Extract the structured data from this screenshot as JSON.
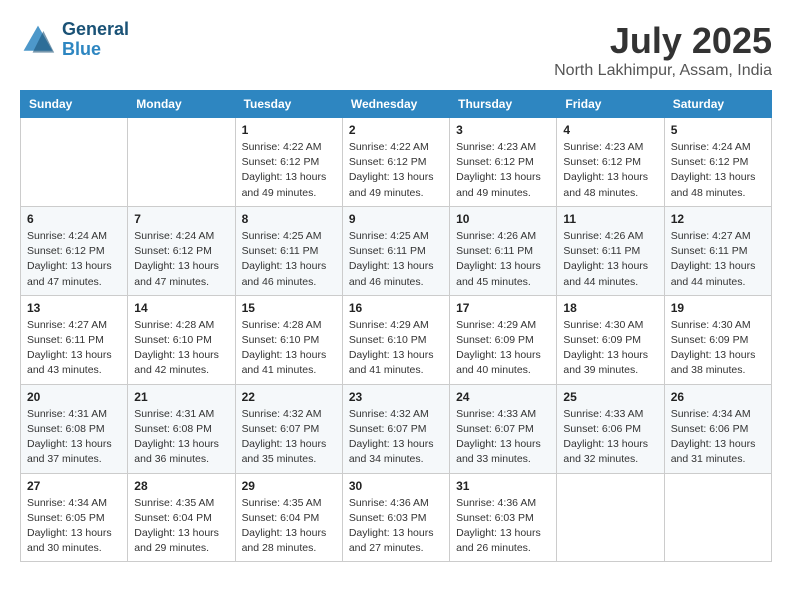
{
  "header": {
    "logo_line1": "General",
    "logo_line2": "Blue",
    "month": "July 2025",
    "location": "North Lakhimpur, Assam, India"
  },
  "weekdays": [
    "Sunday",
    "Monday",
    "Tuesday",
    "Wednesday",
    "Thursday",
    "Friday",
    "Saturday"
  ],
  "weeks": [
    [
      {
        "day": "",
        "info": ""
      },
      {
        "day": "",
        "info": ""
      },
      {
        "day": "1",
        "info": "Sunrise: 4:22 AM\nSunset: 6:12 PM\nDaylight: 13 hours and 49 minutes."
      },
      {
        "day": "2",
        "info": "Sunrise: 4:22 AM\nSunset: 6:12 PM\nDaylight: 13 hours and 49 minutes."
      },
      {
        "day": "3",
        "info": "Sunrise: 4:23 AM\nSunset: 6:12 PM\nDaylight: 13 hours and 49 minutes."
      },
      {
        "day": "4",
        "info": "Sunrise: 4:23 AM\nSunset: 6:12 PM\nDaylight: 13 hours and 48 minutes."
      },
      {
        "day": "5",
        "info": "Sunrise: 4:24 AM\nSunset: 6:12 PM\nDaylight: 13 hours and 48 minutes."
      }
    ],
    [
      {
        "day": "6",
        "info": "Sunrise: 4:24 AM\nSunset: 6:12 PM\nDaylight: 13 hours and 47 minutes."
      },
      {
        "day": "7",
        "info": "Sunrise: 4:24 AM\nSunset: 6:12 PM\nDaylight: 13 hours and 47 minutes."
      },
      {
        "day": "8",
        "info": "Sunrise: 4:25 AM\nSunset: 6:11 PM\nDaylight: 13 hours and 46 minutes."
      },
      {
        "day": "9",
        "info": "Sunrise: 4:25 AM\nSunset: 6:11 PM\nDaylight: 13 hours and 46 minutes."
      },
      {
        "day": "10",
        "info": "Sunrise: 4:26 AM\nSunset: 6:11 PM\nDaylight: 13 hours and 45 minutes."
      },
      {
        "day": "11",
        "info": "Sunrise: 4:26 AM\nSunset: 6:11 PM\nDaylight: 13 hours and 44 minutes."
      },
      {
        "day": "12",
        "info": "Sunrise: 4:27 AM\nSunset: 6:11 PM\nDaylight: 13 hours and 44 minutes."
      }
    ],
    [
      {
        "day": "13",
        "info": "Sunrise: 4:27 AM\nSunset: 6:11 PM\nDaylight: 13 hours and 43 minutes."
      },
      {
        "day": "14",
        "info": "Sunrise: 4:28 AM\nSunset: 6:10 PM\nDaylight: 13 hours and 42 minutes."
      },
      {
        "day": "15",
        "info": "Sunrise: 4:28 AM\nSunset: 6:10 PM\nDaylight: 13 hours and 41 minutes."
      },
      {
        "day": "16",
        "info": "Sunrise: 4:29 AM\nSunset: 6:10 PM\nDaylight: 13 hours and 41 minutes."
      },
      {
        "day": "17",
        "info": "Sunrise: 4:29 AM\nSunset: 6:09 PM\nDaylight: 13 hours and 40 minutes."
      },
      {
        "day": "18",
        "info": "Sunrise: 4:30 AM\nSunset: 6:09 PM\nDaylight: 13 hours and 39 minutes."
      },
      {
        "day": "19",
        "info": "Sunrise: 4:30 AM\nSunset: 6:09 PM\nDaylight: 13 hours and 38 minutes."
      }
    ],
    [
      {
        "day": "20",
        "info": "Sunrise: 4:31 AM\nSunset: 6:08 PM\nDaylight: 13 hours and 37 minutes."
      },
      {
        "day": "21",
        "info": "Sunrise: 4:31 AM\nSunset: 6:08 PM\nDaylight: 13 hours and 36 minutes."
      },
      {
        "day": "22",
        "info": "Sunrise: 4:32 AM\nSunset: 6:07 PM\nDaylight: 13 hours and 35 minutes."
      },
      {
        "day": "23",
        "info": "Sunrise: 4:32 AM\nSunset: 6:07 PM\nDaylight: 13 hours and 34 minutes."
      },
      {
        "day": "24",
        "info": "Sunrise: 4:33 AM\nSunset: 6:07 PM\nDaylight: 13 hours and 33 minutes."
      },
      {
        "day": "25",
        "info": "Sunrise: 4:33 AM\nSunset: 6:06 PM\nDaylight: 13 hours and 32 minutes."
      },
      {
        "day": "26",
        "info": "Sunrise: 4:34 AM\nSunset: 6:06 PM\nDaylight: 13 hours and 31 minutes."
      }
    ],
    [
      {
        "day": "27",
        "info": "Sunrise: 4:34 AM\nSunset: 6:05 PM\nDaylight: 13 hours and 30 minutes."
      },
      {
        "day": "28",
        "info": "Sunrise: 4:35 AM\nSunset: 6:04 PM\nDaylight: 13 hours and 29 minutes."
      },
      {
        "day": "29",
        "info": "Sunrise: 4:35 AM\nSunset: 6:04 PM\nDaylight: 13 hours and 28 minutes."
      },
      {
        "day": "30",
        "info": "Sunrise: 4:36 AM\nSunset: 6:03 PM\nDaylight: 13 hours and 27 minutes."
      },
      {
        "day": "31",
        "info": "Sunrise: 4:36 AM\nSunset: 6:03 PM\nDaylight: 13 hours and 26 minutes."
      },
      {
        "day": "",
        "info": ""
      },
      {
        "day": "",
        "info": ""
      }
    ]
  ]
}
